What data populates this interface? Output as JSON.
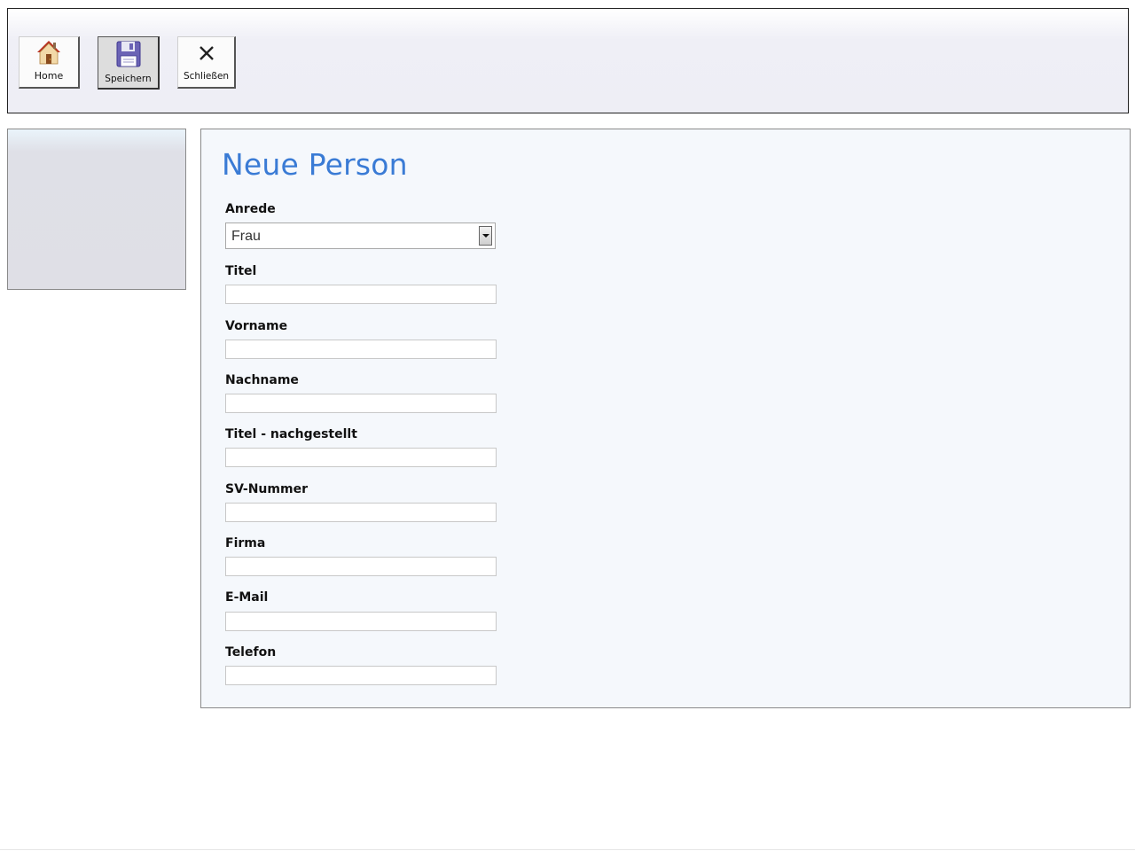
{
  "toolbar": {
    "home_label": "Home",
    "save_label": "Speichern",
    "close_label": "Schließen"
  },
  "form": {
    "title": "Neue Person",
    "anrede": {
      "label": "Anrede",
      "value": "Frau"
    },
    "titel": {
      "label": "Titel",
      "value": ""
    },
    "vorname": {
      "label": "Vorname",
      "value": ""
    },
    "nachname": {
      "label": "Nachname",
      "value": ""
    },
    "titel_nachgestellt": {
      "label": "Titel - nachgestellt",
      "value": ""
    },
    "sv_nummer": {
      "label": "SV-Nummer",
      "value": ""
    },
    "firma": {
      "label": "Firma",
      "value": ""
    },
    "email": {
      "label": "E-Mail",
      "value": ""
    },
    "telefon": {
      "label": "Telefon",
      "value": ""
    }
  },
  "colors": {
    "title": "#3a7bd5",
    "panel_bg": "#f5f8fc",
    "toolbar_bg": "#eeeef5",
    "side_panel_bg": "#dfdfe6"
  },
  "icons": {
    "home": "home-icon",
    "save": "floppy-disk-icon",
    "close": "close-icon"
  }
}
